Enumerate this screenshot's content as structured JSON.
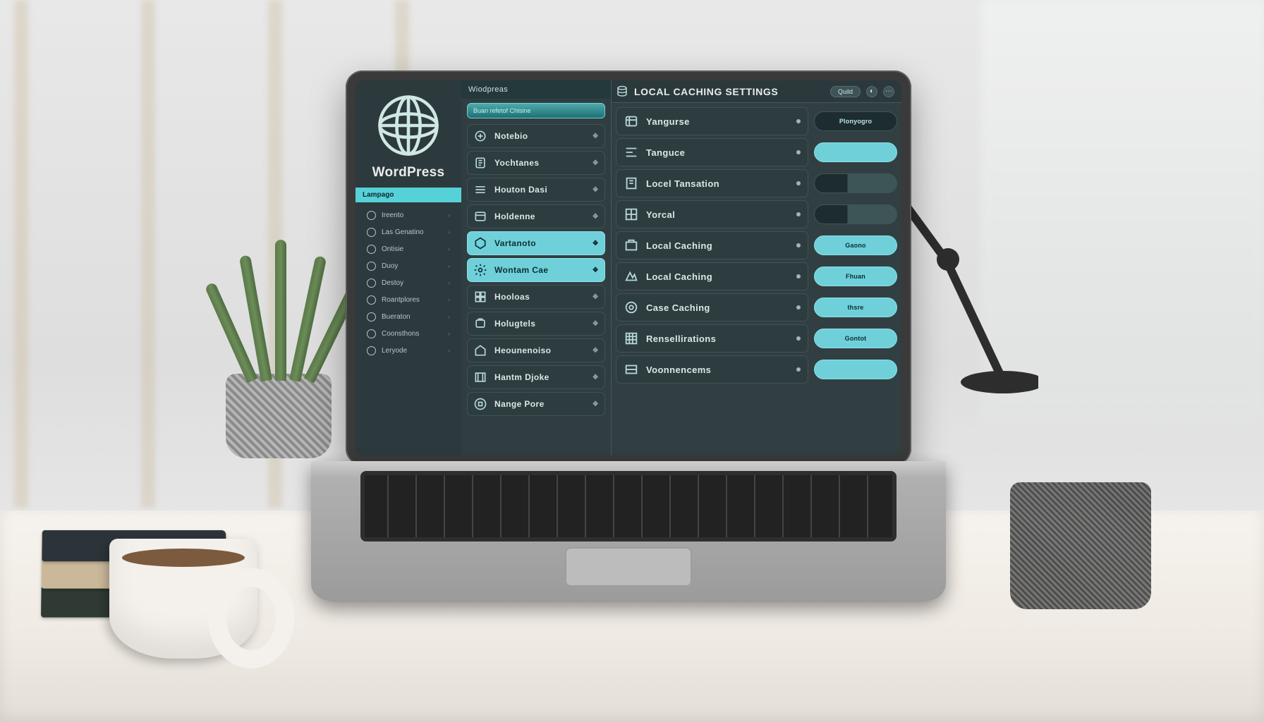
{
  "brand": {
    "name": "WordPress",
    "topbar_label": "Wiodpreas"
  },
  "left_nav": {
    "active": "Lampago",
    "items": [
      {
        "label": "Ireento"
      },
      {
        "label": "Las Genatino"
      },
      {
        "label": "Ontisie"
      },
      {
        "label": "Duoy"
      },
      {
        "label": "Destoy"
      },
      {
        "label": "Roantplores"
      },
      {
        "label": "Bueraton"
      },
      {
        "label": "Coonsthons"
      },
      {
        "label": "Leryode"
      }
    ]
  },
  "menu": {
    "search_placeholder": "Buan refetof Chlsine",
    "items": [
      {
        "label": "Notebio",
        "highlight": false
      },
      {
        "label": "Yochtanes",
        "highlight": false
      },
      {
        "label": "Houton Dasi",
        "highlight": false
      },
      {
        "label": "Holdenne",
        "highlight": false
      },
      {
        "label": "Vartanoto",
        "highlight": true
      },
      {
        "label": "Wontam Cae",
        "highlight": true
      },
      {
        "label": "Hooloas",
        "highlight": false
      },
      {
        "label": "Holugtels",
        "highlight": false
      },
      {
        "label": "Heounenoiso",
        "highlight": false
      },
      {
        "label": "Hantm Djoke",
        "highlight": false
      },
      {
        "label": "Nange Pore",
        "highlight": false
      }
    ]
  },
  "main": {
    "title": "LOCAL CACHING SETTINGS",
    "pill": "Quild",
    "settings": [
      {
        "label": "Yangurse",
        "control": {
          "variant": "dark",
          "text": "Plonyogro"
        }
      },
      {
        "label": "Tanguce",
        "control": {
          "variant": "accent",
          "text": ""
        }
      },
      {
        "label": "Locel Tansation",
        "control": {
          "variant": "slider",
          "text": ""
        }
      },
      {
        "label": "Yorcal",
        "control": {
          "variant": "slider",
          "text": ""
        }
      },
      {
        "label": "Local Caching",
        "control": {
          "variant": "accent",
          "text": "Gaono"
        }
      },
      {
        "label": "Local Caching",
        "control": {
          "variant": "accent",
          "text": "Fhuan"
        }
      },
      {
        "label": "Case Caching",
        "control": {
          "variant": "accent",
          "text": "thsre"
        }
      },
      {
        "label": "Rensellirations",
        "control": {
          "variant": "accent",
          "text": "Gontot"
        }
      },
      {
        "label": "Voonnencems",
        "control": {
          "variant": "accent",
          "text": ""
        }
      }
    ]
  }
}
